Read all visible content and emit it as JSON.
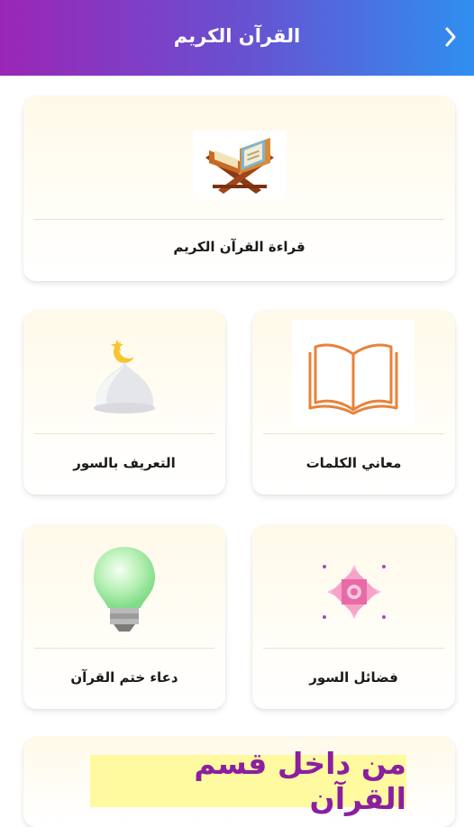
{
  "header": {
    "title": "القرآن الكريم",
    "back_icon": "chevron-right-icon"
  },
  "cards": {
    "reading": {
      "label": "قراءة القرآن الكريم",
      "icon": "quran-stand-icon"
    },
    "word_meanings": {
      "label": "معاني الكلمات",
      "icon": "open-book-icon"
    },
    "surah_intro": {
      "label": "التعريف بالسور",
      "icon": "mosque-dome-icon"
    },
    "surah_virtues": {
      "label": "فضائل السور",
      "icon": "islamic-star-icon"
    },
    "khatm_dua": {
      "label": "دعاء ختم القرآن",
      "icon": "lightbulb-icon"
    }
  },
  "banner": {
    "text": "من داخل قسم القرآن"
  },
  "colors": {
    "header_start": "#9b26b6",
    "header_end": "#2f8ff0",
    "banner_bg": "#fffaa0",
    "banner_text": "#8a1fa0",
    "book_orange": "#e8823a"
  }
}
